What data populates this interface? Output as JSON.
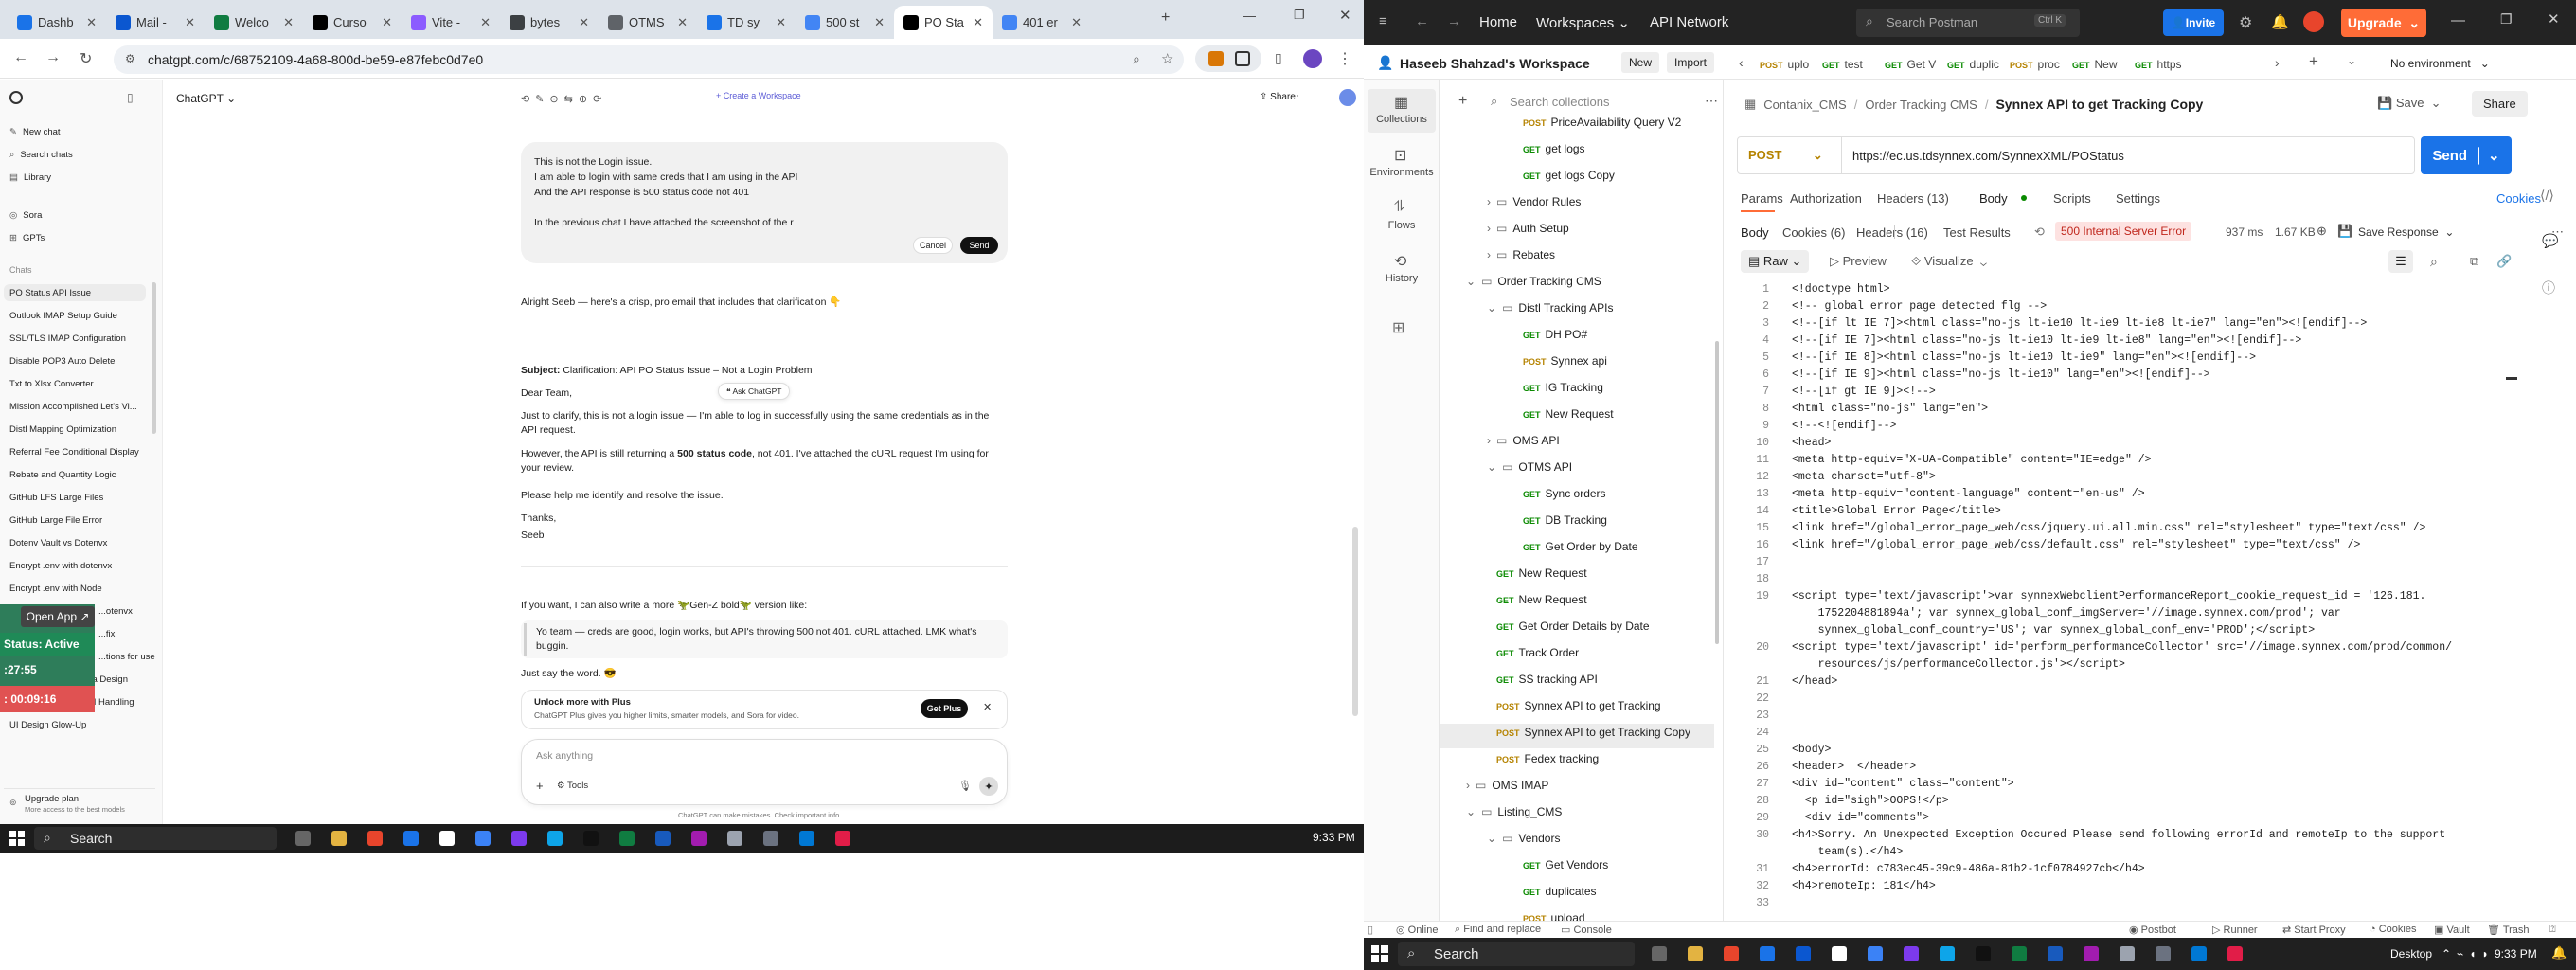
{
  "chrome": {
    "tabs": [
      {
        "label": "Dashb",
        "color": "#1a73e8"
      },
      {
        "label": "Mail -",
        "color": "#0b57d0"
      },
      {
        "label": "Welco",
        "color": "#107c41"
      },
      {
        "label": "Curso",
        "color": "#000000"
      },
      {
        "label": "Vite -",
        "color": "#8c5cff"
      },
      {
        "label": "bytes",
        "color": "#3c4043"
      },
      {
        "label": "OTMS",
        "color": "#5f6368"
      },
      {
        "label": "TD sy",
        "color": "#1a73e8"
      },
      {
        "label": "500 st",
        "color": "#4285f4"
      },
      {
        "label": "PO Sta",
        "color": "#000000"
      },
      {
        "label": "401 er",
        "color": "#4285f4"
      }
    ],
    "url": "chatgpt.com/c/68752109-4a68-800d-be59-e87febc0d7e0"
  },
  "chatgpt": {
    "model": "ChatGPT",
    "create_workspace": "+ Create a Workspace",
    "share": "Share",
    "sidebar_top": [
      "New chat",
      "Search chats",
      "Library"
    ],
    "sidebar_apps": [
      "Sora",
      "GPTs"
    ],
    "chats_header": "Chats",
    "chats": [
      "PO Status API Issue",
      "Outlook IMAP Setup Guide",
      "SSL/TLS IMAP Configuration",
      "Disable POP3 Auto Delete",
      "Txt to Xlsx Converter",
      "Mission Accomplished Let's Vi...",
      "Distl Mapping Optimization",
      "Referral Fee Conditional Display",
      "Rebate and Quantity Logic",
      "GitHub LFS Large Files",
      "GitHub Large File Error",
      "Dotenv Vault vs Dotenvx",
      "Encrypt .env with dotenvx",
      "Encrypt .env with Node",
      "...otenvx",
      "...fix",
      "...tions for use",
      "Non-editable Textarea Design",
      "Upload API with ASIN Handling",
      "UI Design Glow-Up"
    ],
    "upgrade_title": "Upgrade plan",
    "upgrade_sub": "More access to the best models",
    "user_message": [
      "This is not the Login issue.",
      "I am able to login with same creds that I am using in the API",
      "And the API response is 500 status code not 401",
      "",
      "In the previous chat I have attached the screenshot of the r"
    ],
    "cancel": "Cancel",
    "send": "Send",
    "assistant_intro": "Alright Seeb — here's a crisp, pro email that includes that clarification 👇",
    "subject_label": "Subject:",
    "subject_text": "Clarification: API PO Status Issue – Not a Login Problem",
    "dear": "Dear Team,",
    "ask_chatgpt": "❝ Ask ChatGPT",
    "para1": "Just to clarify, this is not a login issue — I'm able to log in successfully using the same credentials as in the API request.",
    "para2_a": "However, the API is still returning a ",
    "para2_b": "500 status code",
    "para2_c": ", not 401. I've attached the cURL request I'm using for your review.",
    "para3": "Please help me identify and resolve the issue.",
    "thanks": "Thanks,",
    "sign": "Seeb",
    "offer": "If you want, I can also write a more 🦖Gen-Z bold🦖 version like:",
    "quote": "Yo team — creds are good, login works, but API's throwing 500 not 401. cURL attached. LMK what's buggin.",
    "say_word": "Just say the word. 😎",
    "plus_title": "Unlock more with Plus",
    "plus_sub": "ChatGPT Plus gives you higher limits, smarter models, and Sora for video.",
    "get_plus": "Get Plus",
    "ask_placeholder": "Ask anything",
    "tools": "Tools",
    "disclaimer": "ChatGPT can make mistakes. Check important info."
  },
  "overlay": {
    "open_app": "Open App ↗",
    "status": "Status: Active",
    "time1": ":27:55",
    "time2": ": 00:09:16"
  },
  "taskbar_left": {
    "search": "Search",
    "time": "9:33 PM"
  },
  "taskbar_right": {
    "search": "Search",
    "desktop": "Desktop",
    "time": "9:33 PM"
  },
  "postman": {
    "nav": [
      "Home",
      "Workspaces",
      "API Network"
    ],
    "search": "Search Postman",
    "shortcut": "Ctrl K",
    "invite": "Invite",
    "upgrade": "Upgrade",
    "workspace": "Haseeb Shahzad's Workspace",
    "new": "New",
    "import": "Import",
    "tabs": [
      {
        "m": "POST",
        "label": "uplo"
      },
      {
        "m": "GET",
        "label": "test"
      },
      {
        "m": "GET",
        "label": "Get V"
      },
      {
        "m": "GET",
        "label": "duplic"
      },
      {
        "m": "POST",
        "label": "proc"
      },
      {
        "m": "GET",
        "label": "New"
      },
      {
        "m": "GET",
        "label": "https"
      }
    ],
    "env": "No environment",
    "rail": [
      "Collections",
      "Environments",
      "Flows",
      "History"
    ],
    "search_collections": "Search collections",
    "tree": [
      {
        "indent": 2,
        "m": "POST",
        "label": "PriceAvailability Query V2"
      },
      {
        "indent": 2,
        "m": "GET",
        "label": "get logs"
      },
      {
        "indent": 2,
        "m": "GET",
        "label": "get logs Copy"
      },
      {
        "indent": 1,
        "folder": true,
        "label": "Vendor Rules"
      },
      {
        "indent": 1,
        "folder": true,
        "label": "Auth Setup"
      },
      {
        "indent": 1,
        "folder": true,
        "label": "Rebates"
      },
      {
        "indent": 0,
        "folder": true,
        "open": true,
        "label": "Order Tracking CMS"
      },
      {
        "indent": 1,
        "folder": true,
        "open": true,
        "label": "Distl Tracking APIs"
      },
      {
        "indent": 2,
        "m": "GET",
        "label": "DH PO#"
      },
      {
        "indent": 2,
        "m": "POST",
        "label": "Synnex api"
      },
      {
        "indent": 2,
        "m": "GET",
        "label": "IG Tracking"
      },
      {
        "indent": 2,
        "m": "GET",
        "label": "New Request"
      },
      {
        "indent": 1,
        "folder": true,
        "label": "OMS API"
      },
      {
        "indent": 1,
        "folder": true,
        "open": true,
        "label": "OTMS API"
      },
      {
        "indent": 2,
        "m": "GET",
        "label": "Sync orders"
      },
      {
        "indent": 2,
        "m": "GET",
        "label": "DB Tracking"
      },
      {
        "indent": 2,
        "m": "GET",
        "label": "Get Order by Date"
      },
      {
        "indent": 1,
        "m": "GET",
        "label": "New Request"
      },
      {
        "indent": 1,
        "m": "GET",
        "label": "New Request"
      },
      {
        "indent": 1,
        "m": "GET",
        "label": "Get Order Details by Date"
      },
      {
        "indent": 1,
        "m": "GET",
        "label": "Track Order"
      },
      {
        "indent": 1,
        "m": "GET",
        "label": "SS tracking API"
      },
      {
        "indent": 1,
        "m": "POST",
        "label": "Synnex API to get Tracking"
      },
      {
        "indent": 1,
        "m": "POST",
        "label": "Synnex API to get Tracking Copy",
        "selected": true
      },
      {
        "indent": 1,
        "m": "POST",
        "label": "Fedex tracking"
      },
      {
        "indent": 0,
        "folder": true,
        "label": "OMS IMAP"
      },
      {
        "indent": 0,
        "folder": true,
        "open": true,
        "label": "Listing_CMS"
      },
      {
        "indent": 1,
        "folder": true,
        "open": true,
        "label": "Vendors"
      },
      {
        "indent": 2,
        "m": "GET",
        "label": "Get Vendors"
      },
      {
        "indent": 2,
        "m": "GET",
        "label": "duplicates"
      },
      {
        "indent": 2,
        "m": "POST",
        "label": "upload"
      }
    ],
    "breadcrumb": [
      "Contanix_CMS",
      "Order Tracking CMS",
      "Synnex API to get Tracking Copy"
    ],
    "save": "Save",
    "share": "Share",
    "method": "POST",
    "url": "https://ec.us.tdsynnex.com/SynnexXML/POStatus",
    "send": "Send",
    "req_tabs": [
      "Params",
      "Authorization",
      "Headers (13)",
      "Body",
      "Scripts",
      "Settings"
    ],
    "cookies": "Cookies",
    "resp_tabs": [
      "Body",
      "Cookies (6)",
      "Headers (16)",
      "Test Results"
    ],
    "status": "500 Internal Server Error",
    "time": "937 ms",
    "size": "1.67 KB",
    "save_response": "Save Response",
    "view_modes": [
      "Raw",
      "Preview",
      "Visualize"
    ],
    "code": [
      "<!doctype html>",
      "<!-- global error page detected flg -->",
      "<!--[if lt IE 7]><html class=\"no-js lt-ie10 lt-ie9 lt-ie8 lt-ie7\" lang=\"en\"><![endif]-->",
      "<!--[if IE 7]><html class=\"no-js lt-ie10 lt-ie9 lt-ie8\" lang=\"en\"><![endif]-->",
      "<!--[if IE 8]><html class=\"no-js lt-ie10 lt-ie9\" lang=\"en\"><![endif]-->",
      "<!--[if IE 9]><html class=\"no-js lt-ie10\" lang=\"en\"><![endif]-->",
      "<!--[if gt IE 9]><!-->",
      "<html class=\"no-js\" lang=\"en\">",
      "<!--<![endif]-->",
      "<head>",
      "<meta http-equiv=\"X-UA-Compatible\" content=\"IE=edge\" />",
      "<meta charset=\"utf-8\">",
      "<meta http-equiv=\"content-language\" content=\"en-us\" />",
      "<title>Global Error Page</title>",
      "<link href=\"/global_error_page_web/css/jquery.ui.all.min.css\" rel=\"stylesheet\" type=\"text/css\" />",
      "<link href=\"/global_error_page_web/css/default.css\" rel=\"stylesheet\" type=\"text/css\" />",
      "",
      "",
      "<script type='text/javascript'>var synnexWebclientPerformanceReport_cookie_request_id = '126.181.",
      "    1752204881894a'; var synnex_global_conf_imgServer='//image.synnex.com/prod'; var",
      "    synnex_global_conf_country='US'; var synnex_global_conf_env='PROD';</script>",
      "<script type='text/javascript' id='perform_performanceCollector' src='//image.synnex.com/prod/common/",
      "    resources/js/performanceCollector.js'></script>",
      "</head>",
      "",
      "",
      "",
      "<body>",
      "<header>  </header>",
      "<div id=\"content\" class=\"content\">",
      "  <p id=\"sigh\">OOPS!</p>",
      "  <div id=\"comments\">",
      "<h4>Sorry. An Unexpected Exception Occured Please send following errorId and remoteIp to the support",
      "    team(s).</h4>",
      "<h4>errorId: c783ec45-39c9-486a-81b2-1cf0784927cb</h4>",
      "<h4>remoteIp: 181</h4>",
      ""
    ],
    "line_numbers": [
      "1",
      "2",
      "3",
      "4",
      "5",
      "6",
      "7",
      "8",
      "9",
      "10",
      "11",
      "12",
      "13",
      "14",
      "15",
      "16",
      "17",
      "18",
      "19",
      "",
      "",
      "20",
      "",
      "21",
      "22",
      "23",
      "24",
      "25",
      "26",
      "27",
      "28",
      "29",
      "30",
      "",
      "31",
      "32",
      "33"
    ],
    "status_bar": [
      "Online",
      "Find and replace",
      "Console",
      "Postbot",
      "Runner",
      "Start Proxy",
      "Cookies",
      "Vault",
      "Trash"
    ]
  }
}
